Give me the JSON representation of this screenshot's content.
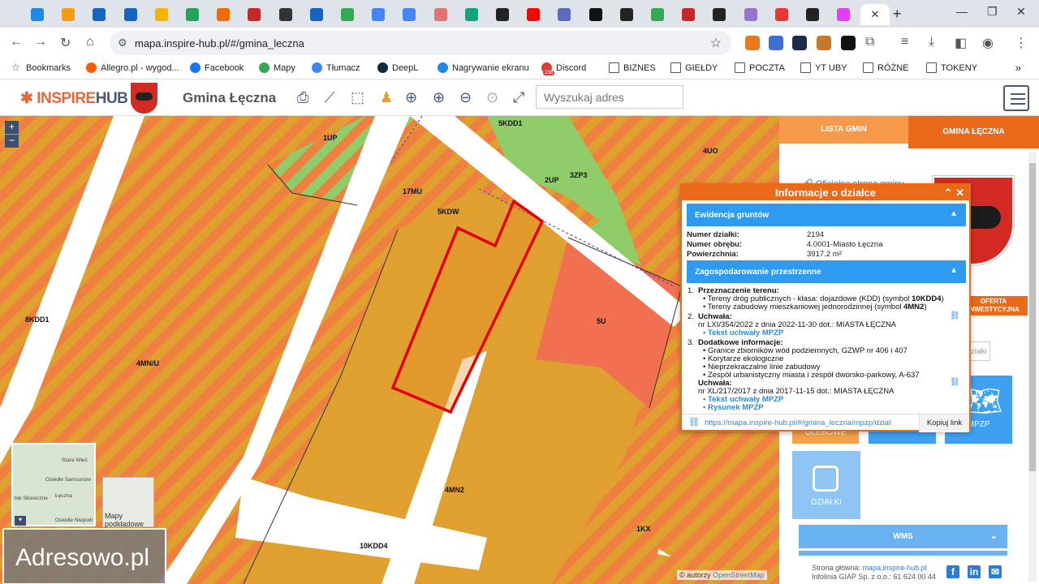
{
  "browser": {
    "url": "mapa.inspire-hub.pl/#/gmina_leczna",
    "tab_close": "✕",
    "new_tab": "+",
    "tab_favicon_colors": [
      "#1e88e5",
      "#f39c12",
      "#1565c0",
      "#1565c0",
      "#f5b400",
      "#22a55a",
      "#ef6c00",
      "#c62828",
      "#333333",
      "#1565c0",
      "#34a853",
      "#4285f4",
      "#4285f4",
      "#e57373",
      "#12a37f",
      "#222222",
      "#ff0000",
      "#5c6bc0",
      "#111111",
      "#222222",
      "#34a853",
      "#c62828",
      "#222222",
      "#9575cd",
      "#e53935",
      "#222222",
      "#e040fb",
      "#777777"
    ],
    "bookmarks": [
      {
        "label": "Bookmarks",
        "icon": "star-icon",
        "color": "#555555"
      },
      {
        "label": "Allegro.pl - wygod...",
        "icon": "allegro-icon",
        "color": "#ff5a00"
      },
      {
        "label": "Facebook",
        "icon": "facebook-icon",
        "color": "#1877f2"
      },
      {
        "label": "Mapy",
        "icon": "maps-icon",
        "color": "#34a853"
      },
      {
        "label": "Tłumacz",
        "icon": "translate-icon",
        "color": "#4285f4"
      },
      {
        "label": "DeepL",
        "icon": "deepl-icon",
        "color": "#0f2b46"
      },
      {
        "label": "Nagrywanie ekranu",
        "icon": "text-cursor-icon",
        "color": "#1e88e5"
      },
      {
        "label": "Discord",
        "icon": "discord-icon",
        "color": "#e53935"
      },
      {
        "label": "BIZNES",
        "icon": "folder-icon",
        "color": "#555555"
      },
      {
        "label": "GIEŁDY",
        "icon": "folder-icon",
        "color": "#555555"
      },
      {
        "label": "POCZTA",
        "icon": "folder-icon",
        "color": "#555555"
      },
      {
        "label": "YT UBY",
        "icon": "folder-icon",
        "color": "#555555"
      },
      {
        "label": "RÓŻNE",
        "icon": "folder-icon",
        "color": "#555555"
      },
      {
        "label": "TOKENY",
        "icon": "folder-icon",
        "color": "#555555"
      }
    ],
    "discord_badge": "158"
  },
  "app": {
    "logo_prefix": "INSPIRE",
    "logo_suffix": "HUB",
    "gmina_title": "Gmina Łęczna",
    "search_placeholder": "Wyszukaj adres"
  },
  "map": {
    "labels": [
      "5KDD1",
      "1UP",
      "4UO",
      "17MU",
      "2UP",
      "3ZP3",
      "5KDW",
      "8KDD1",
      "5U",
      "4MN/U",
      "4MN2",
      "1KX",
      "10KDD4"
    ],
    "zoom_in": "+",
    "zoom_out": "−",
    "minimap_labels": [
      "Stara Wieś",
      "Osiedle Samsonów",
      "Łęczna",
      "ble Słoneczne",
      "Osiedle Niepodl"
    ],
    "basemaps_label": "Mapy podkładowe",
    "watermark": "Adresowo.pl",
    "attribution_prefix": "© autorzy",
    "attribution_link": "OpenStreetMap",
    "colors": {
      "mn": "#e0a030",
      "hatch_orange": "#f08040",
      "hatch_green": "#8fcc6a",
      "service": "#f07050",
      "parcel": "#e60000",
      "road": "#ffffff"
    }
  },
  "sidebar": {
    "tab_list": "LISTA GMIN",
    "tab_gmina": "GMINA ŁĘCZNA",
    "official_link": "Oficjalna strona gminy",
    "offer": "OFERTA INWESTYCYJNA",
    "search_parcels": "działki",
    "tile_gleb": "GLEBOWE",
    "tile_mpzp": "MPZP",
    "tile_dzialki": "DZIAŁKI",
    "wms": "WMS",
    "footer_main_label": "Strona główna:",
    "footer_main_link": "mapa.inspire-hub.pl",
    "footer_infolinia": "Infolinia GIAP Sp. z o.o.: 61 624 00 44"
  },
  "popup": {
    "title": "Informacje o działce",
    "section1": "Ewidencja gruntów",
    "rows": [
      {
        "k": "Numer działki:",
        "v": "2194"
      },
      {
        "k": "Numer obrębu:",
        "v": "4.0001-Miasto Łęczna"
      },
      {
        "k": "Powierzchnia:",
        "v": "3917.2 m²"
      }
    ],
    "section2": "Zagospodarowanie przestrzenne",
    "z1_num": "1.",
    "z1_head": "Przeznaczenie terenu:",
    "z1_b1_pre": "• Tereny dróg publicznych - klasa: dojazdowe (KDD) (symbol ",
    "z1_b1_sym": "10KDD4",
    "z1_b1_post": ")",
    "z1_b2_pre": "• Tereny zabudowy mieszkaniowej jednorodzinnej (symbol ",
    "z1_b2_sym": "4MN2",
    "z1_b2_post": ")",
    "z2_num": "2.",
    "z2_head": "Uchwała:",
    "z2_text": "nr LXI/354/2022 z dnia 2022-11-30 dot.: MIASTA ŁĘCZNA",
    "z2_link": "• Tekst uchwały MPZP",
    "z3_num": "3.",
    "z3_head": "Dodatkowe informacje:",
    "z3_items": [
      "• Granice zbiorników wód podziemnych, GZWP nr 406 i 407",
      "• Korytarze ekologiczne",
      "• Nieprzekraczalne linie zabudowy",
      "• Zespół urbanistyczny miasta i zespół dworsko-parkowy, A-637"
    ],
    "z3_uchwala": "Uchwała:",
    "z3_text": "nr XL/217/2017 z dnia 2017-11-15 dot.: MIASTA ŁĘCZNA",
    "z3_link1": "• Tekst uchwały MPZP",
    "z3_link2": "• Rysunek MPZP",
    "share_url": "https://mapa.inspire-hub.pl/#/gmina_leczna/mpzp/dzialka",
    "copy_label": "Kopiuj link"
  }
}
